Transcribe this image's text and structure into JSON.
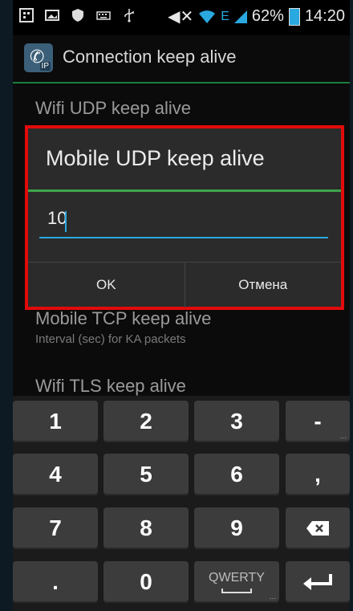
{
  "status_bar": {
    "battery": "62%",
    "time": "14:20",
    "network": "E",
    "icons": [
      "bbm-icon",
      "image-icon",
      "shield-icon",
      "keyboard-icon",
      "usb-icon",
      "mute-icon",
      "wifi-icon",
      "signal-icon",
      "battery-icon"
    ]
  },
  "action_bar": {
    "title": "Connection keep alive",
    "icon_badge": "IP"
  },
  "background_list": {
    "wifi_udp_title": "Wifi UDP keep alive",
    "mobile_tcp_title": "Mobile TCP keep alive",
    "mobile_tcp_sub": "Interval (sec) for KA packets",
    "wifi_tls_title": "Wifi TLS keep alive"
  },
  "dialog": {
    "title": "Mobile UDP keep alive",
    "input_value": "10",
    "ok_label": "OK",
    "cancel_label": "Отмена",
    "accent_color": "#3ea44b",
    "highlight_color": "#e10b0b"
  },
  "keyboard": {
    "keys": [
      "1",
      "2",
      "3",
      "-",
      "4",
      "5",
      "6",
      ",",
      "7",
      "8",
      "9",
      ".",
      "0"
    ],
    "qwerty_label": "QWERTY",
    "dots": "..."
  }
}
